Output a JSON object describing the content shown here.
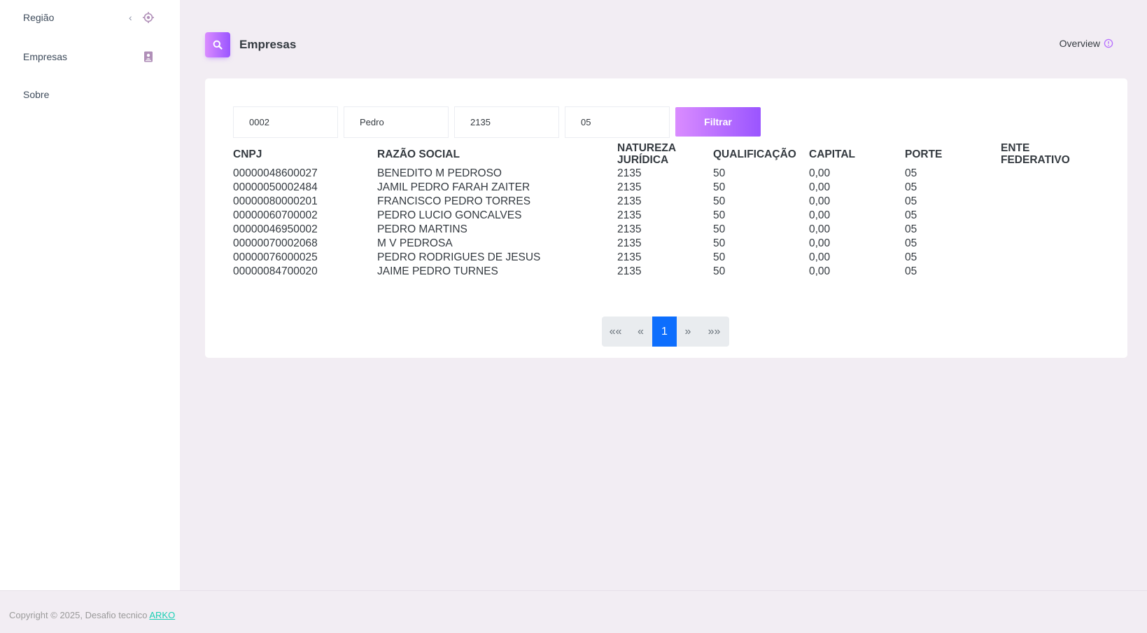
{
  "sidebar": {
    "items": [
      {
        "label": "Região"
      },
      {
        "label": "Empresas"
      },
      {
        "label": "Sobre"
      }
    ]
  },
  "header": {
    "title": "Empresas",
    "overview_label": "Overview"
  },
  "filters": {
    "field1": "0002",
    "field2": "Pedro",
    "field3": "2135",
    "field4": "05",
    "button_label": "Filtrar"
  },
  "table": {
    "columns": [
      "CNPJ",
      "RAZÃO SOCIAL",
      "NATUREZA JURÍDICA",
      "QUALIFICAÇÃO",
      "CAPITAL",
      "PORTE",
      "ENTE FEDERATIVO"
    ],
    "rows": [
      [
        "00000048600027",
        "BENEDITO M PEDROSO",
        "2135",
        "50",
        "0,00",
        "05",
        ""
      ],
      [
        "00000050002484",
        "JAMIL PEDRO FARAH ZAITER",
        "2135",
        "50",
        "0,00",
        "05",
        ""
      ],
      [
        "00000080000201",
        "FRANCISCO PEDRO TORRES",
        "2135",
        "50",
        "0,00",
        "05",
        ""
      ],
      [
        "00000060700002",
        "PEDRO LUCIO GONCALVES",
        "2135",
        "50",
        "0,00",
        "05",
        ""
      ],
      [
        "00000046950002",
        "PEDRO MARTINS",
        "2135",
        "50",
        "0,00",
        "05",
        ""
      ],
      [
        "00000070002068",
        "M V PEDROSA",
        "2135",
        "50",
        "0,00",
        "05",
        ""
      ],
      [
        "00000076000025",
        "PEDRO RODRIGUES DE JESUS",
        "2135",
        "50",
        "0,00",
        "05",
        ""
      ],
      [
        "00000084700020",
        "JAIME PEDRO TURNES",
        "2135",
        "50",
        "0,00",
        "05",
        ""
      ]
    ]
  },
  "pagination": {
    "first": "««",
    "prev": "«",
    "current": "1",
    "next": "»",
    "last": "»»"
  },
  "footer": {
    "copyright": "Copyright © 2025, Desafio tecnico",
    "link_text": "ARKO"
  },
  "colors": {
    "accent_gradient_start": "#da8cff",
    "accent_gradient_end": "#9a55ff",
    "active_page": "#0d6efd",
    "footer_link": "#1bcfb4"
  }
}
